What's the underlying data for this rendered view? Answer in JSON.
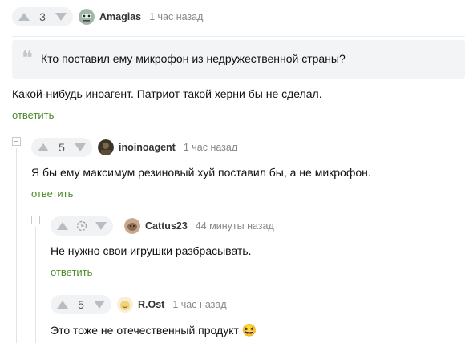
{
  "comment1": {
    "score": "3",
    "author": "Amagias",
    "time": "1 час назад",
    "quote": "Кто поставил ему микрофон из недружественной страны?",
    "text": "Какой-нибудь иноагент. Патриот такой херни бы не сделал.",
    "reply_label": "ответить"
  },
  "comment2": {
    "score": "5",
    "author": "inoinoagent",
    "time": "1 час назад",
    "text": "Я бы ему максимум резиновый хуй поставил бы, а не микрофон.",
    "reply_label": "ответить"
  },
  "comment3": {
    "author": "Cattus23",
    "time": "44 минуты назад",
    "text": "Не нужно свои игрушки разбрасывать.",
    "reply_label": "ответить"
  },
  "comment4": {
    "score": "5",
    "author": "R.Ost",
    "time": "1 час назад",
    "text": "Это тоже не отечественный продукт",
    "emoji": "😆"
  },
  "colors": {
    "accent_link": "#4c8b2b",
    "pill_bg": "#f1f2f3",
    "quote_bg": "#f3f4f5"
  }
}
